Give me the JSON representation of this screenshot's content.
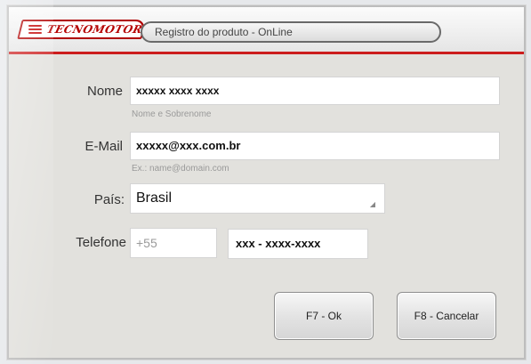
{
  "window": {
    "logo_text": "TECNOMOTOR",
    "title": "Registro do produto - OnLine"
  },
  "form": {
    "name": {
      "label": "Nome",
      "value": "xxxxx xxxx xxxx",
      "hint": "Nome e Sobrenome"
    },
    "email": {
      "label": "E-Mail",
      "value": "xxxxx@xxx.com.br",
      "hint": "Ex.: name@domain.com"
    },
    "country": {
      "label": "País:",
      "value": "Brasil"
    },
    "phone": {
      "label": "Telefone",
      "country_code_placeholder": "+55",
      "number_value": "xxx - xxxx-xxxx"
    }
  },
  "buttons": {
    "ok_label": "F7 - Ok",
    "cancel_label": "F8 - Cancelar"
  },
  "colors": {
    "accent_red": "#cc1d1d",
    "logo_red": "#b50000"
  },
  "icons": {
    "logo": "tecnomotor-logo-icon",
    "dropdown": "dropdown-arrow-icon"
  }
}
